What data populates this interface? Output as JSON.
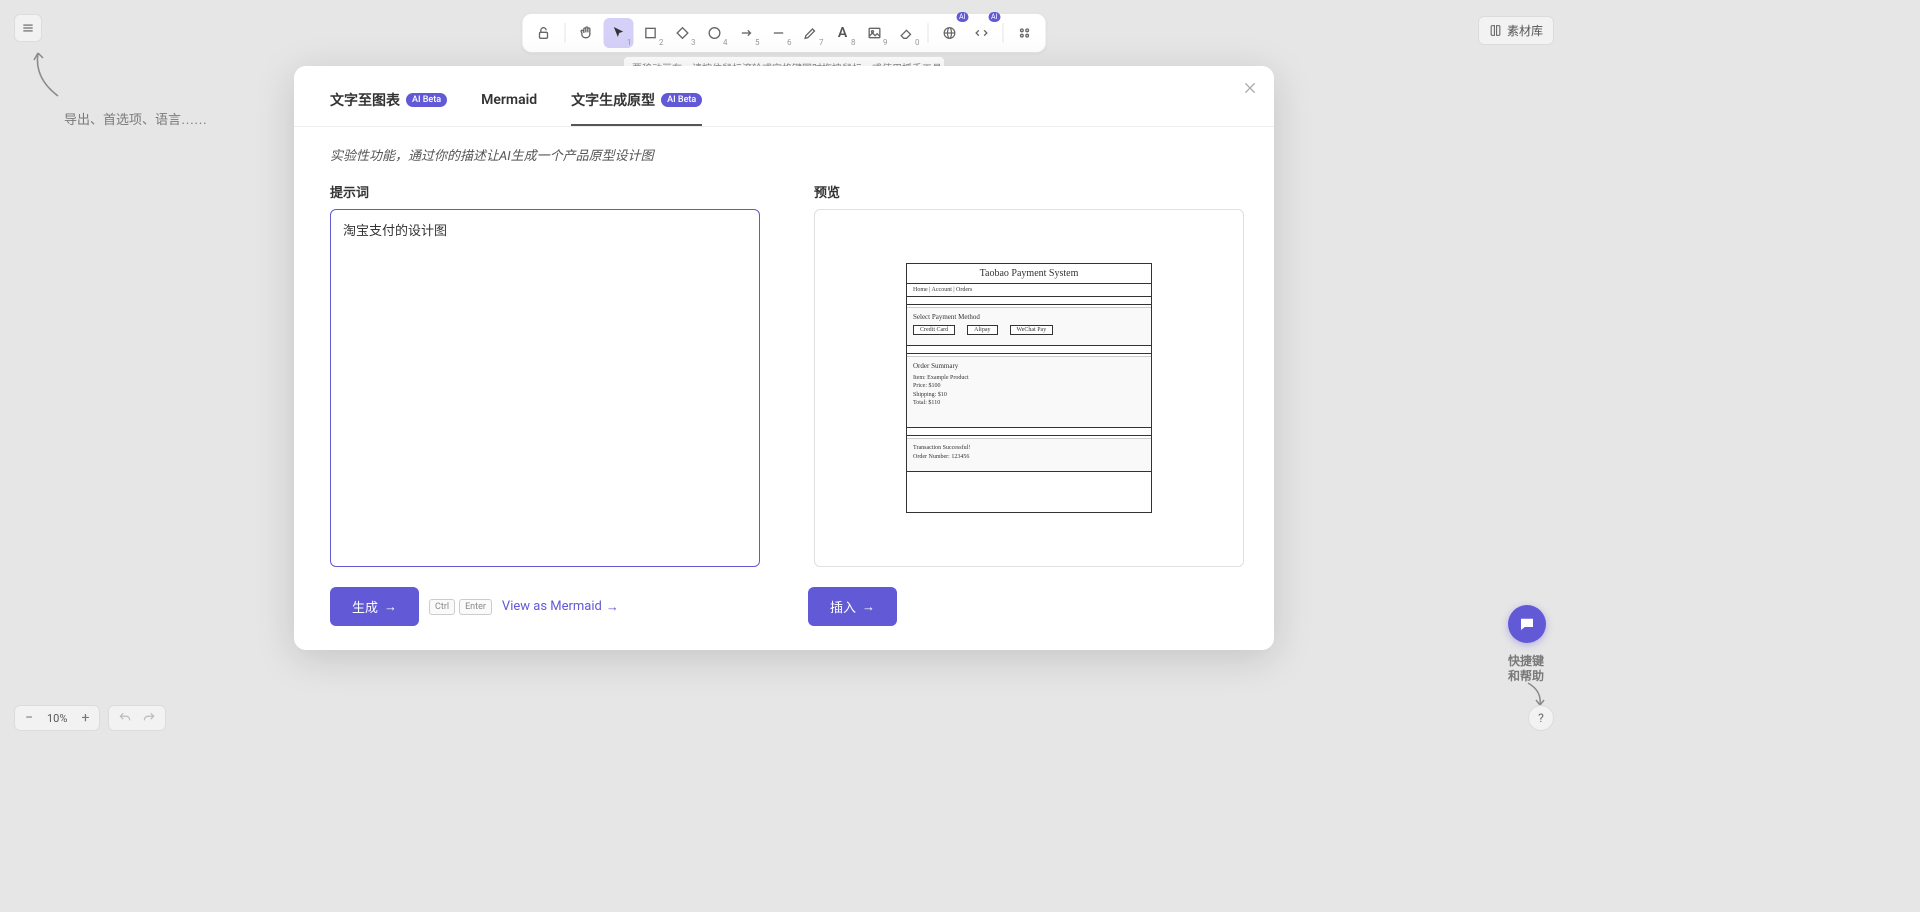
{
  "hint_top_left": "导出、首选项、语言……",
  "canvas_hint": "要移动画布，请按住鼠标滚轮或空格键同时拖拽鼠标，或使用抓手工具",
  "library_button": "素材库",
  "hint_bottom_right_line1": "快捷键",
  "hint_bottom_right_line2": "和帮助",
  "zoom": {
    "value": "10%"
  },
  "toolbar": {
    "badge_ai": "AI"
  },
  "modal": {
    "tabs": {
      "diagram": "文字至图表",
      "mermaid": "Mermaid",
      "prototype": "文字生成原型",
      "ai_beta": "AI Beta"
    },
    "experimental_note": "实验性功能，通过你的描述让AI生成一个产品原型设计图",
    "prompt_label": "提示词",
    "preview_label": "预览",
    "prompt_value": "淘宝支付的设计图",
    "generate_button": "生成",
    "ctrl": "Ctrl",
    "enter": "Enter",
    "view_as_mermaid": "View as Mermaid",
    "insert_button": "插入"
  },
  "wireframe": {
    "title": "Taobao Payment System",
    "nav": "Home | Account | Orders",
    "section_payment": "Select Payment Method",
    "pm1": "Credit Card",
    "pm2": "Alipay",
    "pm3": "WeChat Pay",
    "order_summary_head": "Order Summary",
    "order_item": "Item: Example Product",
    "order_price": "Price: $100",
    "order_shipping": "Shipping: $10",
    "order_total": "Total: $110",
    "txn_success": "Transaction Successful!",
    "txn_number": "Order Number: 123456"
  }
}
